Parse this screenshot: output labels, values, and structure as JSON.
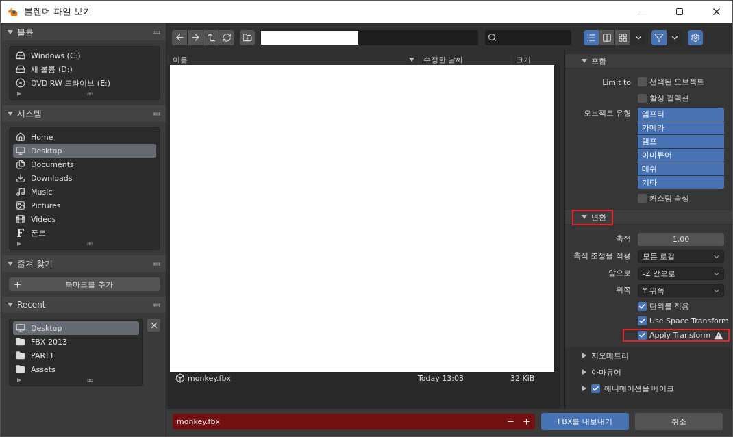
{
  "window": {
    "title": "블렌더 파일 보기"
  },
  "sidebar": {
    "sections": [
      {
        "kind": "list",
        "title": "볼륨",
        "expanded": true,
        "items": [
          {
            "label": "Windows (C:)",
            "kind": "drive",
            "selected": false
          },
          {
            "label": "새 볼륨 (D:)",
            "kind": "drive",
            "selected": false
          },
          {
            "label": "DVD RW 드라이브 (E:)",
            "kind": "disc",
            "selected": false
          }
        ]
      },
      {
        "kind": "list",
        "title": "시스템",
        "expanded": true,
        "items": [
          {
            "label": "Home",
            "kind": "home",
            "selected": false
          },
          {
            "label": "Desktop",
            "kind": "desktop",
            "selected": true
          },
          {
            "label": "Documents",
            "kind": "documents",
            "selected": false
          },
          {
            "label": "Downloads",
            "kind": "downloads",
            "selected": false
          },
          {
            "label": "Music",
            "kind": "music",
            "selected": false
          },
          {
            "label": "Pictures",
            "kind": "pictures",
            "selected": false
          },
          {
            "label": "Videos",
            "kind": "videos",
            "selected": false
          },
          {
            "label": "폰트",
            "kind": "font",
            "selected": false
          }
        ]
      },
      {
        "kind": "bookmarks",
        "title": "즐겨 찾기",
        "expanded": true,
        "button": "북마크를 추가"
      },
      {
        "kind": "recent",
        "title": "Recent",
        "expanded": true,
        "items": [
          {
            "label": "Desktop",
            "kind": "desktop",
            "selected": true
          },
          {
            "label": "FBX 2013",
            "kind": "folder",
            "selected": false
          },
          {
            "label": "PART1",
            "kind": "folder",
            "selected": false
          },
          {
            "label": "Assets",
            "kind": "folder",
            "selected": false
          }
        ]
      }
    ]
  },
  "toolbar": {
    "view_modes": [
      {
        "selected": true
      },
      {
        "selected": false
      },
      {
        "selected": false
      }
    ],
    "filter": {
      "on": true
    }
  },
  "file_list": {
    "columns": [
      {
        "label": "이름",
        "sorted": true
      },
      {
        "label": "수정한 날짜",
        "sorted": false
      },
      {
        "label": "크기",
        "sorted": false
      }
    ],
    "rows": [
      {
        "name": "monkey.fbx",
        "date": "Today 13:03",
        "size": "32 KiB"
      }
    ]
  },
  "options": {
    "panels": [
      {
        "title": "포함",
        "expanded": true,
        "rows": [
          {
            "kind": "checkbox",
            "label": "Limit to",
            "text": "선택된 오브젝트",
            "checked": false
          },
          {
            "kind": "checkbox",
            "text": "활성 컬렉션",
            "checked": false
          },
          {
            "kind": "toggles",
            "label": "오브젝트 유형",
            "options": [
              {
                "text": "엠프티",
                "selected": true
              },
              {
                "text": "카메라",
                "selected": true
              },
              {
                "text": "램프",
                "selected": true
              },
              {
                "text": "아마튜어",
                "selected": true
              },
              {
                "text": "메쉬",
                "selected": true
              },
              {
                "text": "기타",
                "selected": true
              }
            ]
          },
          {
            "kind": "checkbox",
            "text": "커스텀 속성",
            "checked": false
          }
        ]
      },
      {
        "title": "변환",
        "expanded": true,
        "highlighted": true,
        "rows": [
          {
            "kind": "number",
            "label": "축적",
            "value": "1.00"
          },
          {
            "kind": "dropdown",
            "label": "축적 조정을 적용",
            "value": "모든 로컬"
          },
          {
            "kind": "dropdown",
            "label": "앞으로",
            "value": "-Z 앞으로"
          },
          {
            "kind": "dropdown",
            "label": "위쪽",
            "value": "Y 위쪽"
          },
          {
            "kind": "checkbox",
            "text": "단위를 적용",
            "checked": true
          },
          {
            "kind": "checkbox",
            "text": "Use Space Transform",
            "checked": true
          },
          {
            "kind": "checkbox",
            "text": "Apply Transform",
            "checked": true,
            "warning": true,
            "highlighted": true
          }
        ]
      },
      {
        "title": "지오메트리",
        "expanded": false
      },
      {
        "title": "아마튜어",
        "expanded": false
      },
      {
        "title": "에니메이션을 베이크",
        "expanded": false,
        "checked": true
      }
    ]
  },
  "footer": {
    "filename": "monkey.fbx",
    "filename_warning": true,
    "export_button": "FBX를 내보내기",
    "cancel_button": "취소"
  }
}
